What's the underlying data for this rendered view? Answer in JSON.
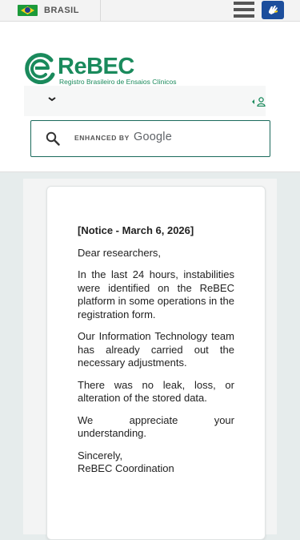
{
  "govbar": {
    "country": "BRASIL",
    "menu_icon": "hamburger-icon",
    "accessibility_icon": "sign-language-icon"
  },
  "header": {
    "logo_text": "ReBEC",
    "logo_subtitle": "Registro Brasileiro de Ensaios Clínicos",
    "brand_color": "#1a8a5c"
  },
  "search": {
    "enhanced_label": "ENHANCED BY",
    "google_label": "Google",
    "icon": "search-icon"
  },
  "notice": {
    "title": "[Notice - March 6, 2026]",
    "greeting": "Dear researchers,",
    "para1": "In the last 24 hours, instabilities were identified on the ReBEC platform in some operations in the registration form.",
    "para2": "Our Information Technology team has already carried out the necessary adjustments.",
    "para3": "There was no leak, loss, or alteration of the stored data.",
    "para4": "We appreciate your understanding.",
    "sign1": "Sincerely,",
    "sign2": "ReBEC Coordination"
  }
}
